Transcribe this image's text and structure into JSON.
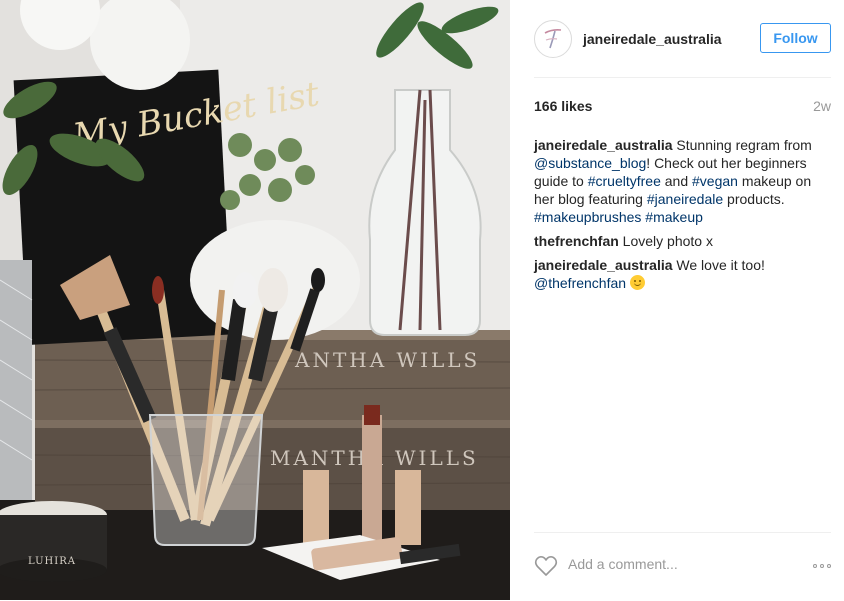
{
  "post": {
    "photo_alt": "Makeup brushes, lipsticks and notebook",
    "photo_text": {
      "notebook": "My Bucket list",
      "box_top": "ANTHA WILLS",
      "box_bottom": "MANTHA WILLS",
      "candle": "LUHIRA"
    }
  },
  "header": {
    "username": "janeiredale_australia",
    "follow_label": "Follow",
    "avatar_icon": "brand-logo-icon"
  },
  "stats": {
    "likes": "166 likes",
    "time": "2w"
  },
  "caption": {
    "author": "janeiredale_australia",
    "parts": [
      {
        "text": " Stunning regram from ",
        "link": false
      },
      {
        "text": "@substance_blog",
        "link": true
      },
      {
        "text": "! Check out her beginners guide to ",
        "link": false
      },
      {
        "text": "#crueltyfree",
        "link": true
      },
      {
        "text": " and ",
        "link": false
      },
      {
        "text": "#vegan",
        "link": true
      },
      {
        "text": " makeup on her blog featuring ",
        "link": false
      },
      {
        "text": "#janeiredale",
        "link": true
      },
      {
        "text": " products. ",
        "link": false
      },
      {
        "text": "#makeupbrushes",
        "link": true
      },
      {
        "text": " ",
        "link": false
      },
      {
        "text": "#makeup",
        "link": true
      }
    ]
  },
  "comments": [
    {
      "author": "thefrenchfan",
      "text": " Lovely photo x"
    },
    {
      "author": "janeiredale_australia",
      "text": " We love it too! ",
      "mention": "@thefrenchfan",
      "emoji": "smile-emoji-icon"
    }
  ],
  "footer": {
    "comment_placeholder": "Add a comment...",
    "like_icon": "heart-icon",
    "more_icon": "more-options-icon"
  },
  "colors": {
    "link": "#003569",
    "follow": "#3897f0",
    "muted": "#999999",
    "text": "#262626"
  }
}
